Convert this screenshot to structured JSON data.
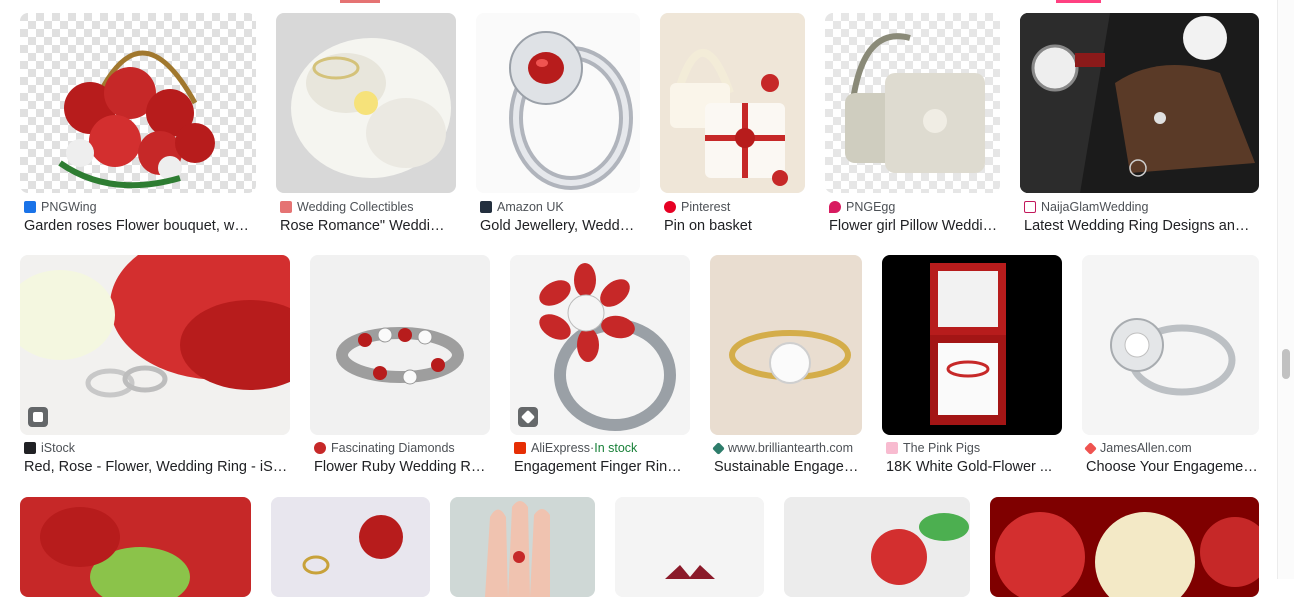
{
  "results": [
    {
      "source": "PNGWing",
      "title": "Garden roses Flower bouquet, wedding ring...",
      "favicon_color": "#1a73e8"
    },
    {
      "source": "Wedding Collectibles",
      "title": "Rose Romance\" Wedding Ring...",
      "favicon_color": "#e57373"
    },
    {
      "source": "Amazon UK",
      "title": "Gold Jewellery, Wedding Ring...",
      "favicon_color": "#232f3e"
    },
    {
      "source": "Pinterest",
      "title": "Pin on basket",
      "favicon_color": "#e60023"
    },
    {
      "source": "PNGEgg",
      "title": "Flower girl Pillow Wedding...",
      "favicon_color": "#d81b60"
    },
    {
      "source": "NaijaGlamWedding",
      "title": "Latest Wedding Ring Designs and ...",
      "favicon_color": "#c2185b"
    },
    {
      "source": "iStock",
      "title": "Red, Rose - Flower, Wedding Ring - iStock",
      "favicon_color": "#202124",
      "badge": "image-badge-icon"
    },
    {
      "source": "Fascinating Diamonds",
      "title": "Flower Ruby Wedding Ring...",
      "favicon_color": "#c62828"
    },
    {
      "source": "AliExpress",
      "stock": "In stock",
      "title": "Engagement Finger Ring...",
      "favicon_color": "#e62e04",
      "badge": "product-tag-icon"
    },
    {
      "source": "www.brilliantearth.com",
      "title": "Sustainable Engagement...",
      "favicon_color": "#2e7d6b"
    },
    {
      "source": "The Pink Pigs",
      "title": "18K White Gold-Flower ...",
      "favicon_color": "#f48fb1"
    },
    {
      "source": "JamesAllen.com",
      "title": "Choose Your Engagement...",
      "favicon_color": "#ef5350"
    }
  ],
  "stock_separator": " · ",
  "colors": {
    "text": "#202124",
    "source": "#4d5156",
    "in_stock": "#188038"
  }
}
